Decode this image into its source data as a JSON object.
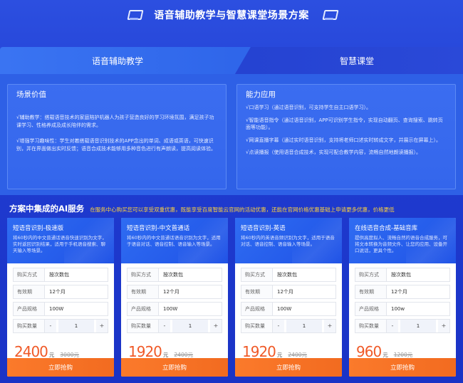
{
  "header": {
    "title": "语音辅助教学与智慧课堂场景方案"
  },
  "tabs": [
    {
      "label": "语音辅助教学"
    },
    {
      "label": "智慧课堂"
    }
  ],
  "left_panel": {
    "title": "场景价值",
    "p1": "√辅助教学：搭载语音技术的家庭陪护机器人为孩子营造良好的学习环境氛围，满足孩子功课学习、性格养成及成长陪伴的需求。",
    "p2": "√增强学习趣味性：学生对着搭载语音识别技术的APP念出的单词、成语或英语，可快速识别，并在界面做出实时反馈；语音合成技术能够用多种音色进行有声朗读，提高阅读体验。"
  },
  "right_panel": {
    "title": "能力应用",
    "items": [
      "√口语学习（通过语音识别，可支持学生自主口语学习）。",
      "√智能语音指令（通过语音识别，APP可识别学生指令，实现自动翻页、查询搜索、跳转页面等功能）。",
      "√网课直播字幕（通过实时语音识别，支持将老师口述实时转成文字，并展示在屏幕上）。",
      "√点读播报（使用语音合成技术，实现可配合教学内容，流畅自然地朗读播报）。"
    ]
  },
  "services": {
    "heading": "方案中集成的AI服务",
    "subtitle": "在服务中心购买您可以享受双重优惠，既能享受百度智能云官网的活动优惠，还能在官网价格优惠基础上申请更多优惠，价格更低",
    "labels": {
      "purchase": "购买方式",
      "validity": "有效期",
      "spec": "产品规格",
      "qty": "购买数量",
      "minus": "-",
      "plus": "+",
      "unit": "元",
      "buy": "立即抢购"
    },
    "cards": [
      {
        "name": "短语音识别-极速版",
        "desc": "将60秒内的中文普通话语音快速识别为文字，实时返回识别结果，适用于手机语音搜索、聊天输入等场景。",
        "purchase": "按次数包",
        "validity": "12个月",
        "spec": "100W",
        "qty": "1",
        "price": "2400",
        "original": "3000元"
      },
      {
        "name": "短语音识别-中文普通话",
        "desc": "将60秒内的中文普通话语音识别为文字，适用于语音对话、语音控制、语音输入等场景。",
        "purchase": "按次数包",
        "validity": "12个月",
        "spec": "100W",
        "qty": "1",
        "price": "1920",
        "original": "2400元"
      },
      {
        "name": "短语音识别-英语",
        "desc": "将60秒内的英语音频识别为文字，适用于语音对话、语音控制、语音输入等场景。",
        "purchase": "按次数包",
        "validity": "12个月",
        "spec": "100W",
        "qty": "1",
        "price": "1920",
        "original": "2400元"
      },
      {
        "name": "在线语音合成-基础音库",
        "desc": "提供高度拟人、流畅自然的语音合成服务，可将文本转换为音频文件、让您的应用、设备开口说话，更具个性。",
        "purchase": "按次数包",
        "validity": "12个月",
        "spec": "100w",
        "qty": "1",
        "price": "960",
        "original": "1200元"
      }
    ]
  },
  "colors": {
    "accent": "#f26b20",
    "primary": "#2f6cf2",
    "highlight": "#ffd23c"
  }
}
